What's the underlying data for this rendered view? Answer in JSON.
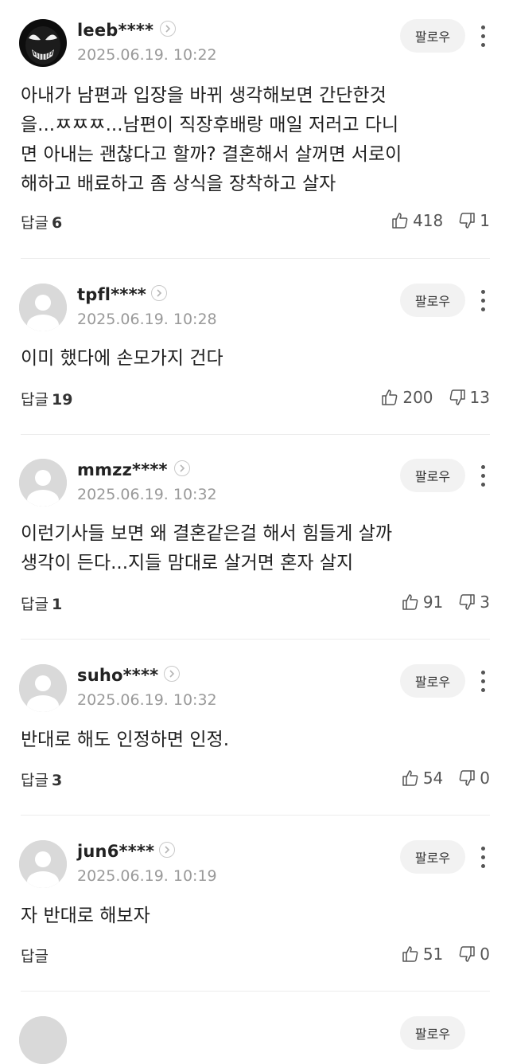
{
  "follow_label": "팔로우",
  "reply_label": "답글",
  "comments": [
    {
      "username": "leeb****",
      "timestamp": "2025.06.19. 10:22",
      "avatar": "venom-avatar",
      "text_lines": [
        "아내가 남편과 입장을 바뀌 생각해보면 간단한것",
        "을...ㅉㅉㅉ...남편이 직장후배랑 매일 저러고 다니",
        "면 아내는 괜찮다고 할까? 결혼해서 살꺼면 서로이",
        "해하고 배료하고 좀 상식을 장착하고 살자"
      ],
      "reply_count": "6",
      "likes": "418",
      "dislikes": "1"
    },
    {
      "username": "tpfl****",
      "timestamp": "2025.06.19. 10:28",
      "avatar": "default-avatar",
      "text_lines": [
        "이미 했다에 손모가지 건다"
      ],
      "reply_count": "19",
      "likes": "200",
      "dislikes": "13"
    },
    {
      "username": "mmzz****",
      "timestamp": "2025.06.19. 10:32",
      "avatar": "default-avatar",
      "text_lines": [
        "이런기사들 보면 왜 결혼같은걸 해서 힘들게 살까",
        "생각이 든다...지들 맘대로 살거면 혼자 살지"
      ],
      "reply_count": "1",
      "likes": "91",
      "dislikes": "3"
    },
    {
      "username": "suho****",
      "timestamp": "2025.06.19. 10:32",
      "avatar": "default-avatar",
      "text_lines": [
        "반대로 해도 인정하면 인정."
      ],
      "reply_count": "3",
      "likes": "54",
      "dislikes": "0"
    },
    {
      "username": "jun6****",
      "timestamp": "2025.06.19. 10:19",
      "avatar": "default-avatar",
      "text_lines": [
        "자 반대로 해보자"
      ],
      "reply_count": "",
      "likes": "51",
      "dislikes": "0"
    }
  ],
  "colors": {
    "follow_bg": "#f2f2f2",
    "timestamp": "#9a9a9a",
    "divider": "#ececec",
    "avatar_default": "#d9d9d9"
  }
}
